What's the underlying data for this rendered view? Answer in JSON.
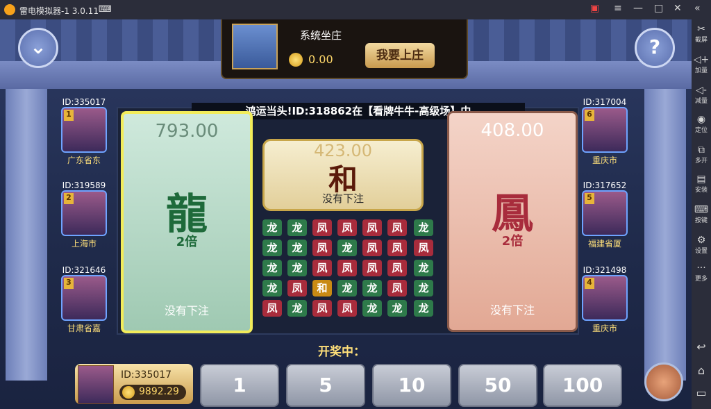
{
  "titlebar": {
    "title": "雷电模拟器-1 3.0.11",
    "gamepad_icon": "gamepad-icon"
  },
  "sidebar": [
    {
      "label": "截屏",
      "icon": "scissors-icon"
    },
    {
      "label": "加量",
      "icon": "volume-up-icon"
    },
    {
      "label": "减量",
      "icon": "volume-down-icon"
    },
    {
      "label": "定位",
      "icon": "location-icon"
    },
    {
      "label": "多开",
      "icon": "multi-window-icon"
    },
    {
      "label": "安装",
      "icon": "apk-install-icon"
    },
    {
      "label": "按键",
      "icon": "keyboard-icon"
    },
    {
      "label": "设置",
      "icon": "gear-icon"
    },
    {
      "label": "更多",
      "icon": "more-icon"
    }
  ],
  "banker": {
    "name": "系统坐庄",
    "amount": "0.00",
    "button": "我要上庄"
  },
  "ticker": "鸿运当头!ID:318862在【看牌牛牛-高级场】中",
  "players_left": [
    {
      "id": "ID:335017",
      "rank": "1",
      "location": "广东省东"
    },
    {
      "id": "ID:319589",
      "rank": "2",
      "location": "上海市"
    },
    {
      "id": "ID:321646",
      "rank": "3",
      "location": "甘肃省嘉"
    }
  ],
  "players_right": [
    {
      "id": "ID:317004",
      "rank": "6",
      "location": "重庆市"
    },
    {
      "id": "ID:317652",
      "rank": "5",
      "location": "福建省厦"
    },
    {
      "id": "ID:321498",
      "rank": "4",
      "location": "重庆市"
    }
  ],
  "dragon": {
    "total": "793.00",
    "glyph": "龍",
    "mult": "2倍",
    "status": "没有下注"
  },
  "phoenix": {
    "total": "408.00",
    "glyph": "鳳",
    "mult": "2倍",
    "status": "没有下注"
  },
  "tie": {
    "total": "423.00",
    "glyph": "和",
    "status": "没有下注"
  },
  "history": [
    [
      "龙",
      "龙",
      "凤",
      "凤",
      "凤",
      "凤",
      "龙"
    ],
    [
      "龙",
      "龙",
      "凤",
      "龙",
      "凤",
      "凤",
      "凤"
    ],
    [
      "龙",
      "龙",
      "凤",
      "凤",
      "凤",
      "凤",
      "龙"
    ],
    [
      "龙",
      "凤",
      "和",
      "龙",
      "龙",
      "凤",
      "龙"
    ],
    [
      "凤",
      "龙",
      "凤",
      "凤",
      "龙",
      "龙",
      "龙"
    ]
  ],
  "status_text": "开奖中：",
  "me": {
    "id": "ID:335017",
    "balance": "9892.29"
  },
  "chips": [
    "1",
    "5",
    "10",
    "50",
    "100"
  ],
  "colors": {
    "dragon": "#2e7a4a",
    "phoenix": "#a82c3c",
    "tie": "#c98a14"
  }
}
